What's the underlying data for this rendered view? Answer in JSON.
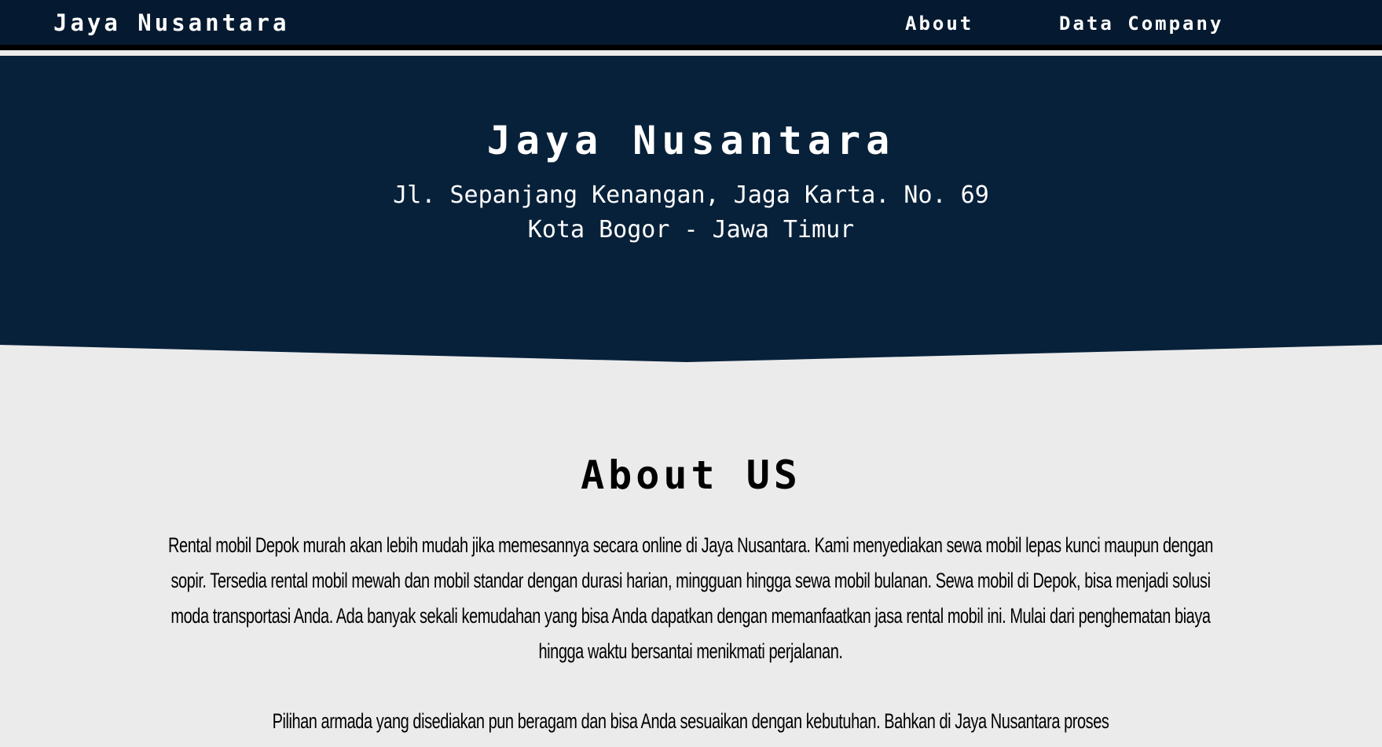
{
  "navbar": {
    "brand": "Jaya Nusantara",
    "links": [
      {
        "label": "About"
      },
      {
        "label": "Data Company"
      }
    ]
  },
  "hero": {
    "title": "Jaya Nusantara",
    "address_line1": "Jl. Sepanjang Kenangan, Jaga Karta. No. 69",
    "address_line2": "Kota Bogor - Jawa Timur"
  },
  "about": {
    "title": "About US",
    "paragraph1": "Rental mobil Depok murah akan lebih mudah jika memesannya secara online di Jaya Nusantara. Kami menyediakan sewa mobil lepas kunci maupun dengan sopir. Tersedia rental mobil mewah dan mobil standar dengan durasi harian, mingguan hingga sewa mobil bulanan. Sewa mobil di Depok, bisa menjadi solusi moda transportasi Anda. Ada banyak sekali kemudahan yang bisa Anda dapatkan dengan memanfaatkan jasa rental mobil ini. Mulai dari penghematan biaya hingga waktu bersantai menikmati perjalanan.",
    "paragraph2": "Pilihan armada yang disediakan pun beragam dan bisa Anda sesuaikan dengan kebutuhan. Bahkan di Jaya Nusantara proses"
  },
  "colors": {
    "navbar_bg": "#051a30",
    "hero_bg": "#08213a",
    "page_bg": "#ebebeb",
    "text_light": "#ffffff",
    "text_dark": "#000000"
  }
}
